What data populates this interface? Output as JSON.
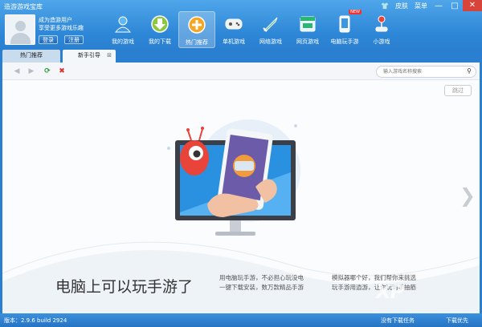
{
  "app": {
    "title": "造游游戏宝库"
  },
  "window": {
    "skin": "皮肤",
    "menu": "菜单",
    "minimize": "—",
    "maximize": "□",
    "close": "✕"
  },
  "user": {
    "line1": "成为造游用户",
    "line2": "享受更多游戏乐趣",
    "login": "登录",
    "register": "注册"
  },
  "nav": {
    "items": [
      {
        "label": "我的游戏"
      },
      {
        "label": "我的下载"
      },
      {
        "label": "热门推荐"
      },
      {
        "label": "单机游戏"
      },
      {
        "label": "网络游戏"
      },
      {
        "label": "网页游戏"
      },
      {
        "label": "电脑玩手游",
        "badge": "NEW"
      },
      {
        "label": "小游戏"
      }
    ]
  },
  "tabs": [
    {
      "label": "热门推荐"
    },
    {
      "label": "新手引导"
    }
  ],
  "toolbar": {
    "search_placeholder": "输入游戏名称搜索"
  },
  "guide": {
    "skip": "跳过",
    "tagline": "电脑上可以玩手游了",
    "desc1_line1": "用电脑玩手游，不必担心玩没电",
    "desc1_line2": "一键下载安装，数万款精品手游",
    "desc2_line1": "模拟器哪个好，我们帮你来挑选",
    "desc2_line2": "玩手游用逍游，让你玩到手抽筋",
    "pages": 8,
    "active_page": 0
  },
  "status": {
    "version": "版本：2.9.6 build 2924",
    "no_download": "没有下载任务",
    "download_priority": "下载优先"
  },
  "watermark": "XP",
  "colors": {
    "accent": "#2a7fd0",
    "status": "#2674c4",
    "dot_active": "#2b8de0",
    "monster": "#e8443a"
  }
}
